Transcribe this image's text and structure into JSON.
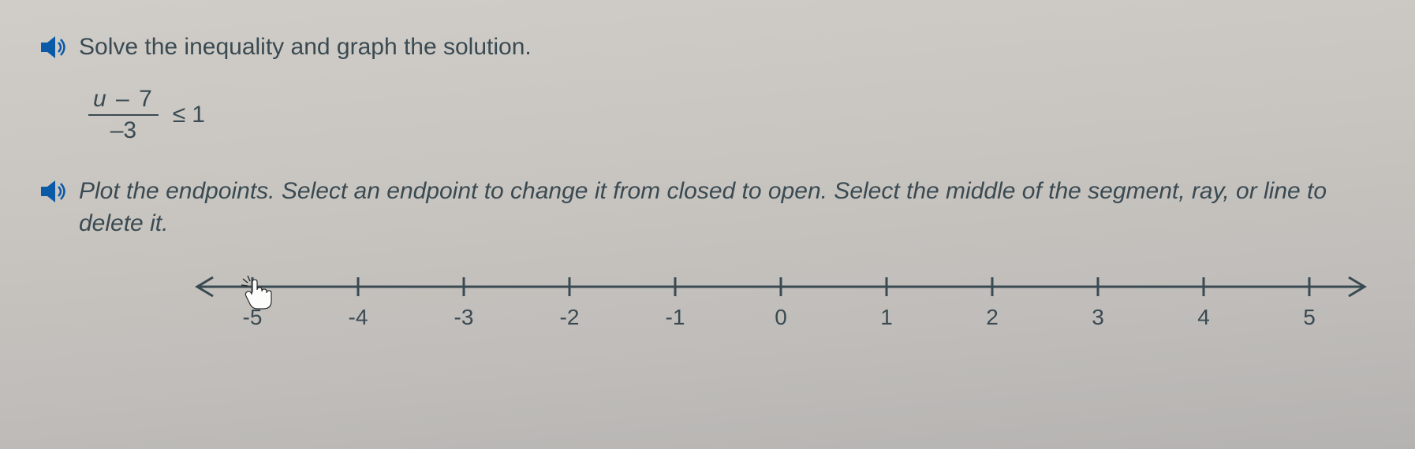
{
  "instruction1": "Solve the inequality and graph the solution.",
  "inequality": {
    "numerator_var": "u",
    "numerator_op": "–",
    "numerator_const": "7",
    "denominator": "–3",
    "operator": "≤",
    "rhs": "1"
  },
  "instruction2": "Plot the endpoints. Select an endpoint to change it from closed to open. Select the middle of the segment, ray, or line to delete it.",
  "numberline": {
    "ticks": [
      "-5",
      "-4",
      "-3",
      "-2",
      "-1",
      "0",
      "1",
      "2",
      "3",
      "4",
      "5"
    ]
  }
}
